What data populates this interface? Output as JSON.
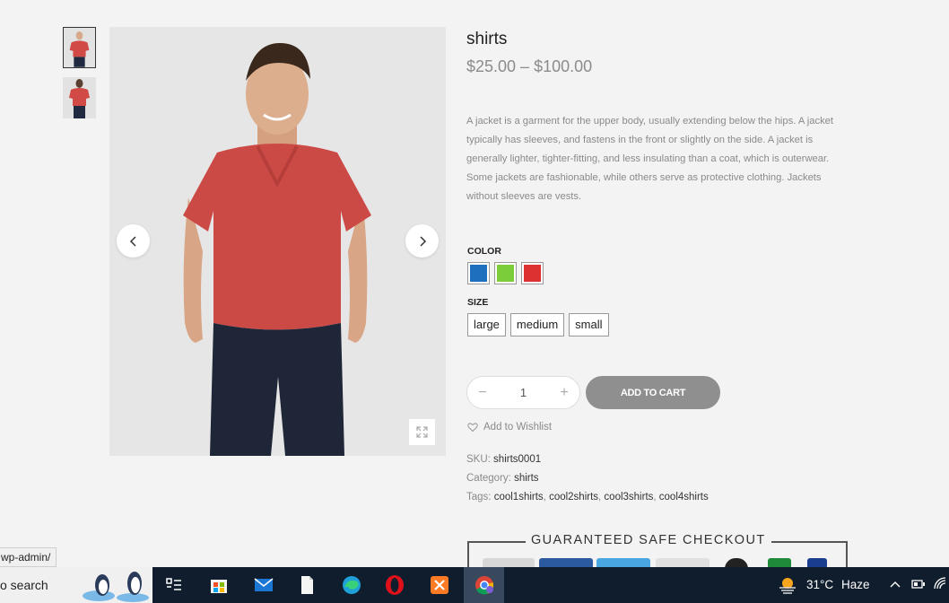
{
  "product": {
    "title": "shirts",
    "price": "$25.00 – $100.00",
    "description": "A jacket is a garment for the upper body, usually extending below the hips. A jacket typically has sleeves, and fastens in the front or slightly on the side. A jacket is generally lighter, tighter-fitting, and less insulating than a coat, which is outerwear. Some jackets are fashionable, while others serve as protective clothing. Jackets without sleeves are vests."
  },
  "gallery": {
    "icons": {
      "prev": "chevron-left-icon",
      "next": "chevron-right-icon",
      "zoom": "expand-icon"
    },
    "thumbnail_count": 2
  },
  "variations": {
    "color_label": "COLOR",
    "colors": [
      {
        "name": "blue",
        "hex": "#1f6fbf"
      },
      {
        "name": "green",
        "hex": "#7ccd3a"
      },
      {
        "name": "red",
        "hex": "#dd3030"
      }
    ],
    "size_label": "SIZE",
    "sizes": [
      "large",
      "medium",
      "small"
    ]
  },
  "cart": {
    "minus": "−",
    "quantity": "1",
    "plus": "+",
    "add_label": "ADD TO CART",
    "button_color": "#8f8f8f"
  },
  "wishlist": {
    "label": "Add to Wishlist",
    "icon": "heart-icon"
  },
  "meta": {
    "sku_label": "SKU:",
    "sku": "shirts0001",
    "category_label": "Category:",
    "category": "shirts",
    "tags_label": "Tags:",
    "tags": [
      "cool1shirts",
      "cool2shirts",
      "cool3shirts",
      "cool4shirts"
    ],
    "tag_separator": ", "
  },
  "checkout": {
    "title": "GUARANTEED SAFE CHECKOUT"
  },
  "status_bar": {
    "url": "wp-admin/"
  },
  "taskbar": {
    "search_text": "o search",
    "apps": [
      "task-view-icon",
      "microsoft-store-icon",
      "mail-icon",
      "file-icon",
      "edge-icon",
      "opera-icon",
      "xampp-icon",
      "chrome-icon"
    ],
    "weather": "31°C",
    "weather_desc": "Haze",
    "background": "#0f1d2d"
  }
}
